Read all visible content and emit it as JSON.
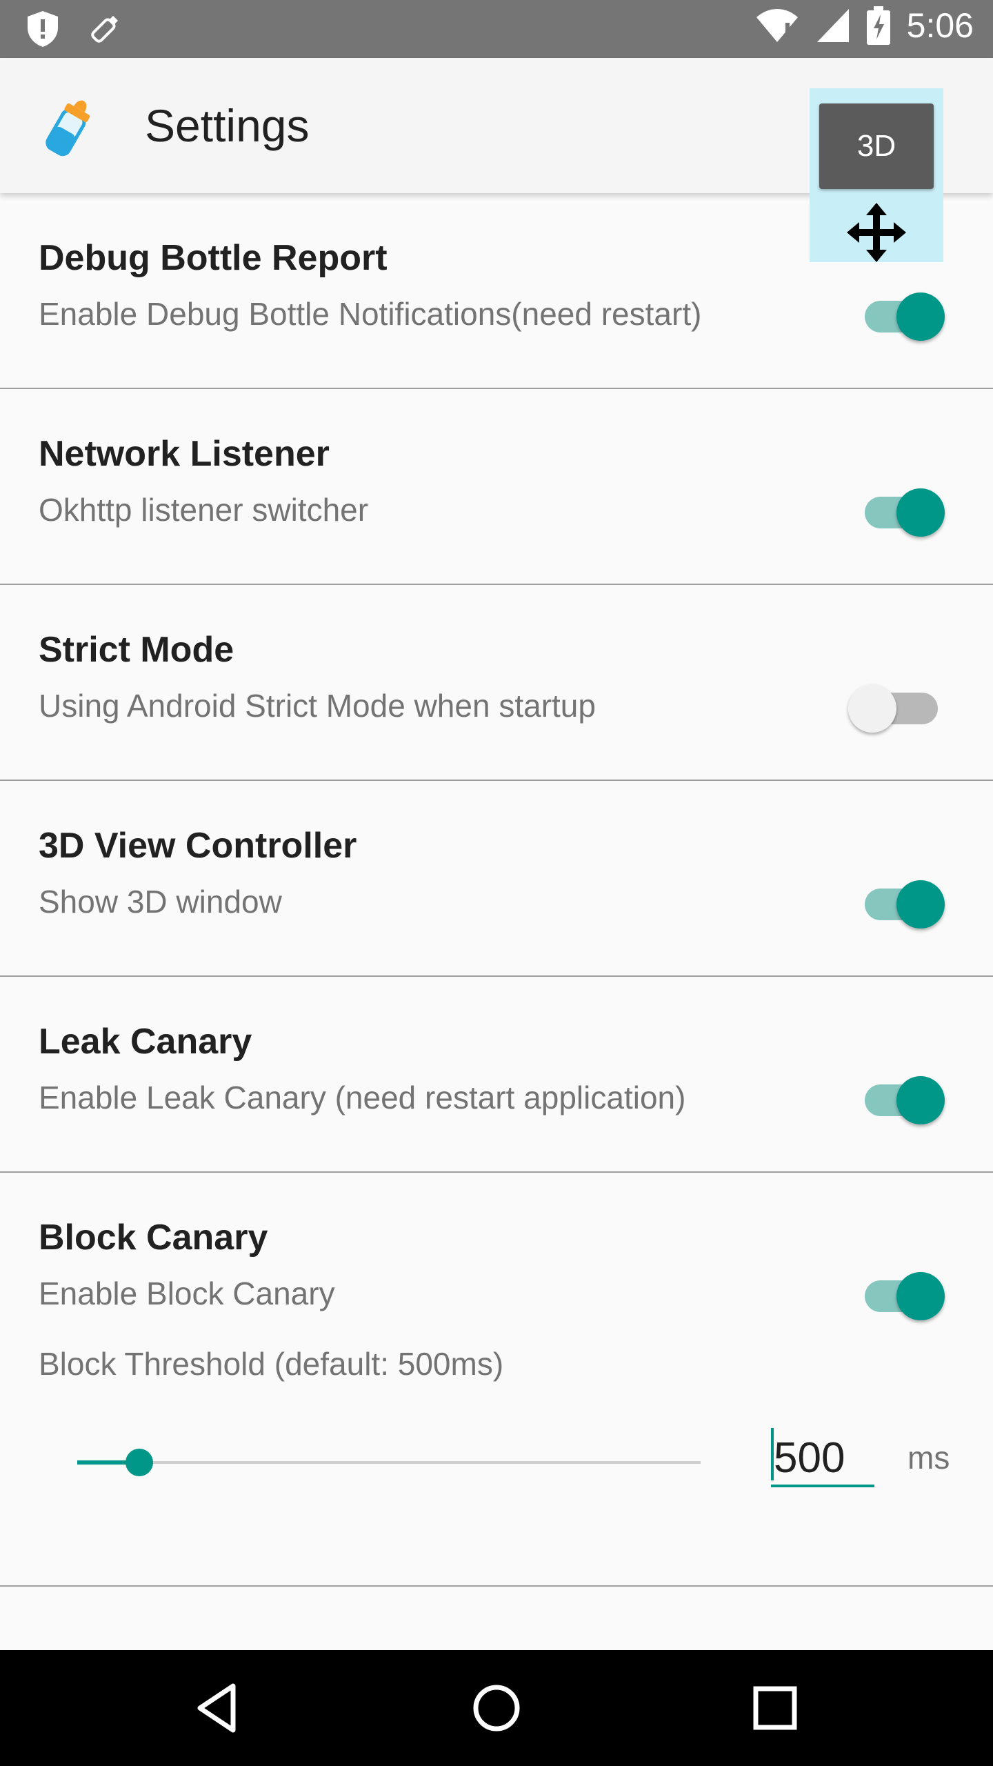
{
  "status_bar": {
    "time": "5:06",
    "left_icons": [
      "shield-icon",
      "debug-bottle-notification-icon"
    ],
    "right_icons": [
      "wifi-icon",
      "cellular-signal-icon",
      "battery-charging-icon"
    ]
  },
  "app_bar": {
    "icon": "baby-bottle-icon",
    "title": "Settings"
  },
  "floating_widget": {
    "button_label": "3D",
    "handle_icon": "move-icon"
  },
  "settings": [
    {
      "title": "Debug Bottle Report",
      "subtitle": "Enable Debug Bottle Notifications(need restart)",
      "enabled": true
    },
    {
      "title": "Network Listener",
      "subtitle": "Okhttp listener switcher",
      "enabled": true
    },
    {
      "title": "Strict Mode",
      "subtitle": "Using Android Strict Mode when startup",
      "enabled": false
    },
    {
      "title": "3D View Controller",
      "subtitle": "Show 3D window",
      "enabled": true
    },
    {
      "title": "Leak Canary",
      "subtitle": "Enable Leak Canary (need restart application)",
      "enabled": true
    },
    {
      "title": "Block Canary",
      "subtitle": "Enable Block Canary",
      "enabled": true
    }
  ],
  "block_threshold": {
    "label": "Block Threshold (default: 500ms)",
    "value": "500",
    "unit": "ms",
    "slider_fraction": 0.1
  },
  "nav_bar": {
    "icons": [
      "back-icon",
      "home-icon",
      "recents-icon"
    ]
  },
  "colors": {
    "accent": "#009688",
    "status_bar": "#757575",
    "app_bar": "#f5f5f5"
  }
}
